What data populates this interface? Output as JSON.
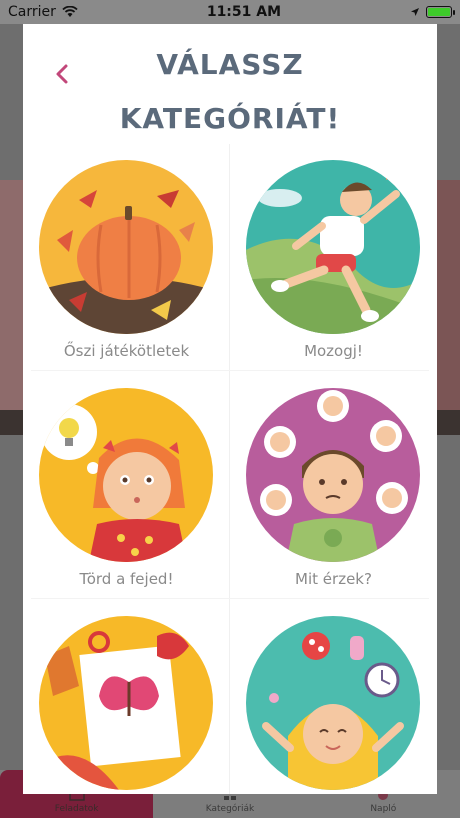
{
  "status_bar": {
    "carrier": "Carrier",
    "time": "11:51 AM"
  },
  "modal": {
    "title_line1": "VÁLASSZ",
    "title_line2": "KATEGÓRIÁT!",
    "categories": [
      {
        "label": "Őszi játékötletek"
      },
      {
        "label": "Mozogj!"
      },
      {
        "label": "Törd a fejed!"
      },
      {
        "label": "Mit érzek?"
      },
      {
        "label": ""
      },
      {
        "label": ""
      }
    ]
  },
  "tabbar": {
    "tabs": [
      {
        "label": "Feladatok"
      },
      {
        "label": "Kategóriák"
      },
      {
        "label": "Napló"
      }
    ]
  },
  "colors": {
    "title": "#5b6a7b",
    "back_arrow": "#c2477a",
    "battery": "#3ecb2b",
    "active_tab": "#7a1f3a"
  }
}
